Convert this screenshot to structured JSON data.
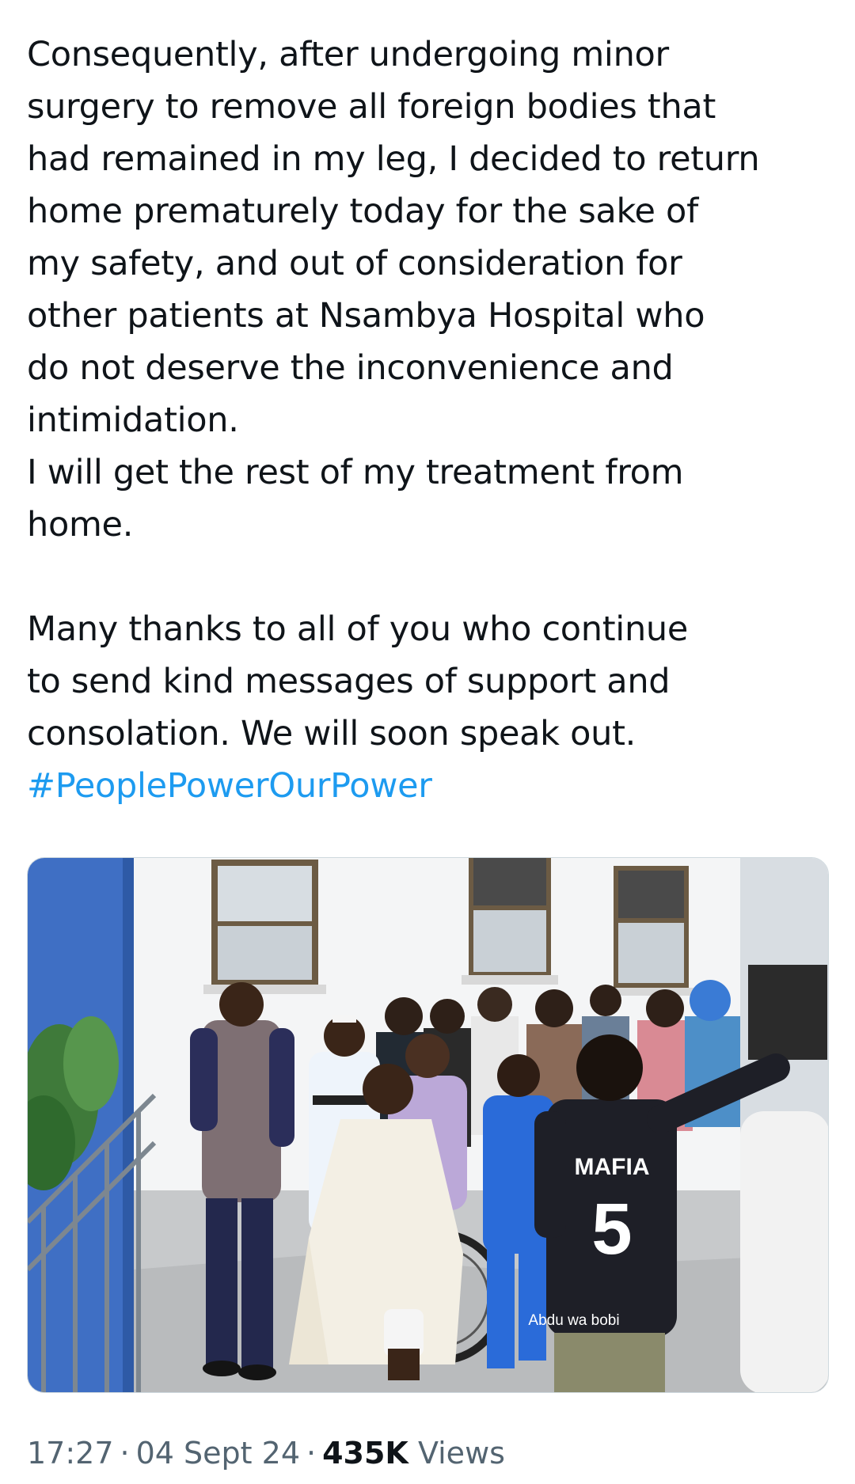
{
  "tweet": {
    "text_lines": [
      "Consequently, after undergoing minor",
      "surgery to remove all foreign bodies that",
      "had remained in my leg, I decided to return",
      "home prematurely today for the sake of",
      "my safety, and out of consideration for",
      "other patients at Nsambya Hospital who",
      "do not deserve the inconvenience and",
      "intimidation.",
      "I will get the rest of my treatment from",
      "home.",
      "",
      "Many thanks to all of you who continue",
      "to send kind messages of support and",
      "consolation. We will soon speak out."
    ],
    "hashtag": "#PeoplePowerOurPower",
    "hashtag_color": "#1d9bf0"
  },
  "media": {
    "watermark": "Abdu wa bobi",
    "jersey_text": "MAFIA",
    "jersey_number": "5"
  },
  "meta": {
    "time": "17:27",
    "separator": "·",
    "date": "04 Sept 24",
    "views_count": "435K",
    "views_label": "Views"
  }
}
